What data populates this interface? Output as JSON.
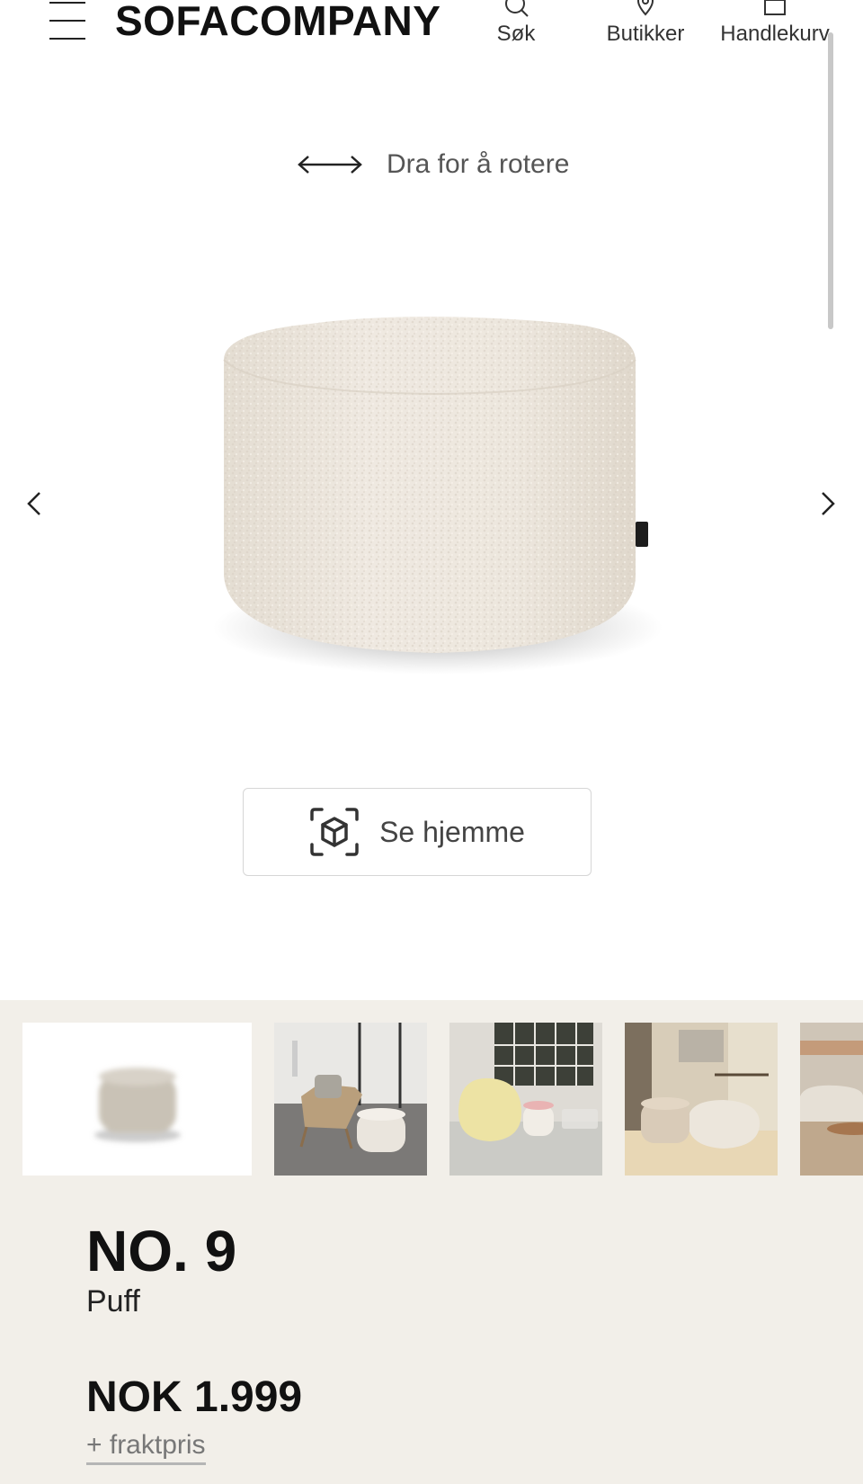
{
  "header": {
    "brand": "SOFACOMPANY",
    "search_label": "Søk",
    "stores_label": "Butikker",
    "cart_label": "Handlekurv"
  },
  "viewer": {
    "rotate_hint": "Dra for å rotere",
    "ar_button_label": "Se hjemme"
  },
  "icons": {
    "menu": "hamburger-menu-icon",
    "search": "search-icon",
    "stores": "location-pin-icon",
    "cart": "shopping-bag-icon",
    "rotate": "double-arrow-icon",
    "ar": "ar-cube-icon",
    "prev": "chevron-left-icon",
    "next": "chevron-right-icon"
  },
  "product": {
    "name": "NO. 9",
    "type": "Puff",
    "price": "NOK 1.999",
    "shipping_note": "+ fraktpris"
  },
  "colors": {
    "product_fabric": "#ede7de",
    "bottom_background": "#f2efe9",
    "text_dark": "#111111"
  }
}
